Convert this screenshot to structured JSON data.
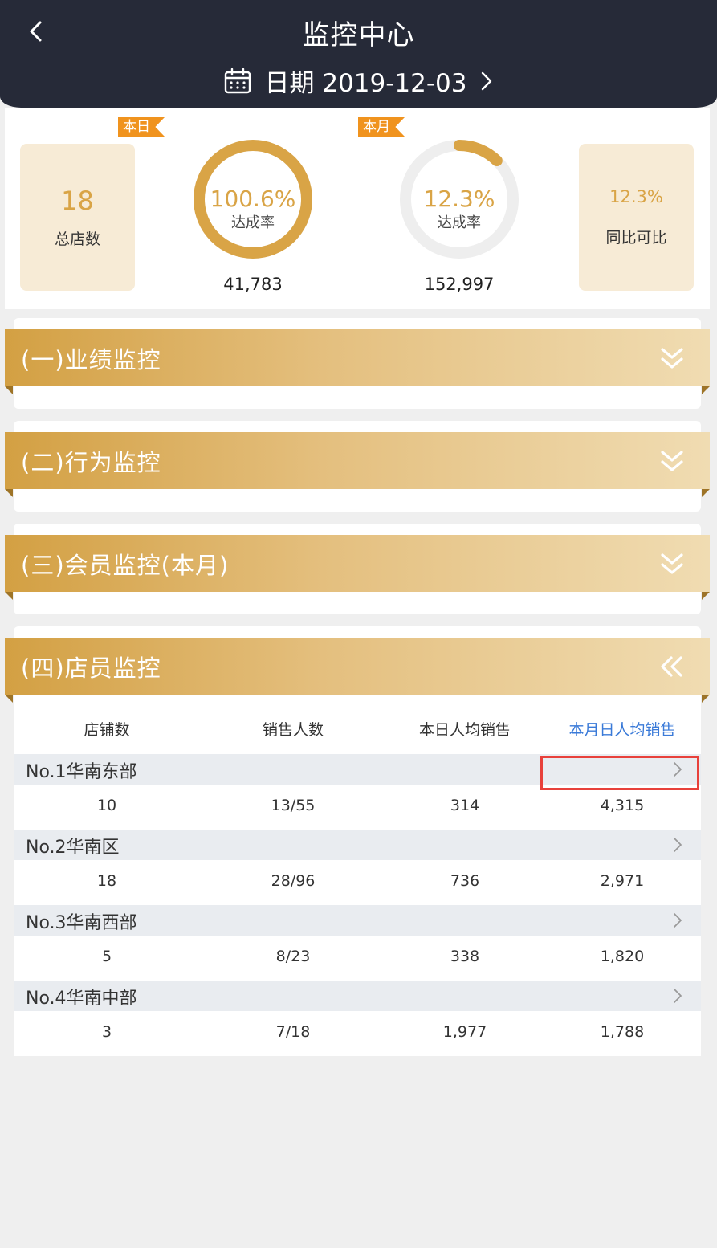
{
  "header": {
    "title": "监控中心",
    "date_text": "日期 2019-12-03"
  },
  "summary": {
    "store_count": {
      "value": "18",
      "label": "总店数"
    },
    "today": {
      "tag": "本日",
      "percent": "100.6%",
      "label": "达成率",
      "total": "41,783",
      "progress": 1.0
    },
    "month": {
      "tag": "本月",
      "percent": "12.3%",
      "label": "达成率",
      "total": "152,997",
      "progress": 0.123
    },
    "yoy": {
      "value": "12.3%",
      "label": "同比可比"
    }
  },
  "sections": [
    {
      "title": "(一)业绩监控",
      "expanded": false
    },
    {
      "title": "(二)行为监控",
      "expanded": false
    },
    {
      "title": "(三)会员监控(本月)",
      "expanded": false
    },
    {
      "title": "(四)店员监控",
      "expanded": true
    }
  ],
  "staff_table": {
    "columns": [
      "店铺数",
      "销售人数",
      "本日人均销售",
      "本月日人均销售"
    ],
    "active_column": 3,
    "groups": [
      {
        "name": "No.1华南东部",
        "stores": "10",
        "sales_staff": "13/55",
        "today_avg": "314",
        "month_avg": "4,315"
      },
      {
        "name": "No.2华南区",
        "stores": "18",
        "sales_staff": "28/96",
        "today_avg": "736",
        "month_avg": "2,971"
      },
      {
        "name": "No.3华南西部",
        "stores": "5",
        "sales_staff": "8/23",
        "today_avg": "338",
        "month_avg": "1,820"
      },
      {
        "name": "No.4华南中部",
        "stores": "3",
        "sales_staff": "7/18",
        "today_avg": "1,977",
        "month_avg": "1,788"
      }
    ]
  },
  "colors": {
    "gold": "#d9a446",
    "header_bg": "#262a38",
    "tag_orange": "#f0931e",
    "link_blue": "#3a7ad8",
    "highlight_red": "#e8413b"
  }
}
